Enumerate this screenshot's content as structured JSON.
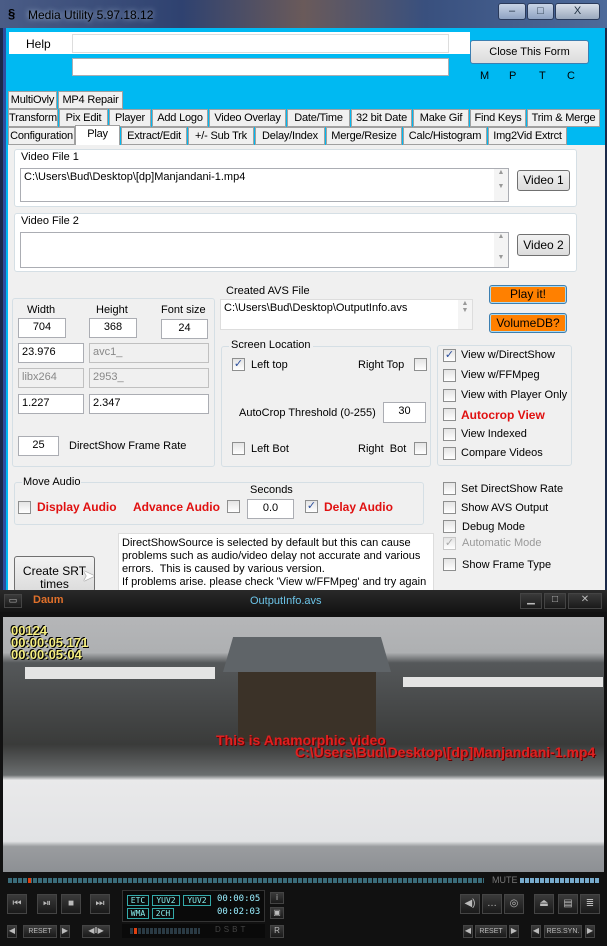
{
  "window": {
    "title": "Media Utility 5.97.18.12",
    "minimize": "‒",
    "maximize": "□",
    "close": "X"
  },
  "header": {
    "help_label": "Help",
    "input1_value": "",
    "input2_value": "",
    "close_form_label": "Close This Form",
    "letters": [
      "M",
      "P",
      "T",
      "C"
    ]
  },
  "tabs": {
    "row1": [
      "MultiOvly",
      "MP4 Repair"
    ],
    "row2": [
      "Transform",
      "Pix Edit",
      "Player",
      "Add Logo",
      "Video Overlay",
      "Date/Time",
      "32 bit Date",
      "Make Gif",
      "Find Keys",
      "Trim & Merge"
    ],
    "row3": [
      "Configuration",
      "Play",
      "Extract/Edit",
      "+/- Sub Trk",
      "Delay/Index",
      "Merge/Resize",
      "Calc/Histogram",
      "Img2Vid Extrct"
    ],
    "selected": "Play"
  },
  "video_file_1": {
    "label": "Video File 1",
    "value": "C:\\Users\\Bud\\Desktop\\[dp]Manjandani-1.mp4",
    "button": "Video 1"
  },
  "video_file_2": {
    "label": "Video File 2",
    "value": "",
    "button": "Video 2"
  },
  "dims": {
    "width_label": "Width",
    "height_label": "Height",
    "font_label": "Font size",
    "width": "704",
    "height": "368",
    "font_size": "24",
    "fps": "23.976",
    "codec": "avc1_",
    "encoder": "libx264",
    "bitrate": "2953_",
    "ratio1": "1.227",
    "ratio2": "2.347",
    "ds_rate": "25",
    "ds_rate_label": "DirectShow Frame Rate"
  },
  "avs": {
    "label": "Created AVS File",
    "value": "C:\\Users\\Bud\\Desktop\\OutputInfo.avs",
    "play_label": "Play it!",
    "volume_label": "VolumeDB?",
    "accent": "#ff8000"
  },
  "screen_location": {
    "label": "Screen Location",
    "left_top": "Left top",
    "left_top_checked": true,
    "right_top": "Right Top",
    "autocrop_label": "AutoCrop Threshold (0-255)",
    "autocrop_value": "30",
    "left_bot": "Left Bot",
    "right_bot": "Right  Bot"
  },
  "view_options": [
    {
      "label": "View w/DirectShow",
      "checked": true
    },
    {
      "label": "View w/FFMpeg",
      "checked": false
    },
    {
      "label": "View with Player Only",
      "checked": false
    },
    {
      "label": "Autocrop View",
      "checked": false,
      "red": true
    },
    {
      "label": "View Indexed",
      "checked": false
    },
    {
      "label": "Compare Videos",
      "checked": false
    }
  ],
  "move_audio": {
    "label": "Move Audio",
    "display": "Display Audio",
    "advance": "Advance Audio",
    "seconds_label": "Seconds",
    "seconds": "0.0",
    "delay": "Delay Audio",
    "delay_checked": true
  },
  "more_options": [
    {
      "label": "Set DirectShow Rate",
      "checked": false
    },
    {
      "label": "Show AVS Output",
      "checked": false
    },
    {
      "label": "Debug Mode",
      "checked": false
    },
    {
      "label": "Automatic Mode",
      "checked": true,
      "disabled": true
    },
    {
      "label": "Show Frame Type",
      "checked": false
    }
  ],
  "srt_button": "Create SRT times",
  "info_text": "DirectShowSource is selected by default but this can cause problems such as audio/video delay not accurate and various errors.  This is caused by various version.\nIf problems arise. please check 'View w/FFMpeg' and try again",
  "player": {
    "logo": "Daum",
    "title": "OutputInfo.avs",
    "overlay_frame": "00124",
    "overlay_time1": "00:00:05.171",
    "overlay_time2": "00:00:05:04",
    "overlay_msg": "This is Anamorphic video",
    "overlay_path": "C:\\Users\\Bud\\Desktop\\[dp]Manjandani-1.mp4",
    "mute": "MUTE",
    "badges": [
      "ETC",
      "YUV2",
      "YUV2",
      "WMA",
      "2CH"
    ],
    "time_elapsed": "00:00:05",
    "time_total": "00:02:03",
    "reset": "RESET",
    "res_sync": "RES.SYN.",
    "r_label": "R",
    "dsbt": [
      "D",
      "S",
      "B",
      "T"
    ]
  }
}
